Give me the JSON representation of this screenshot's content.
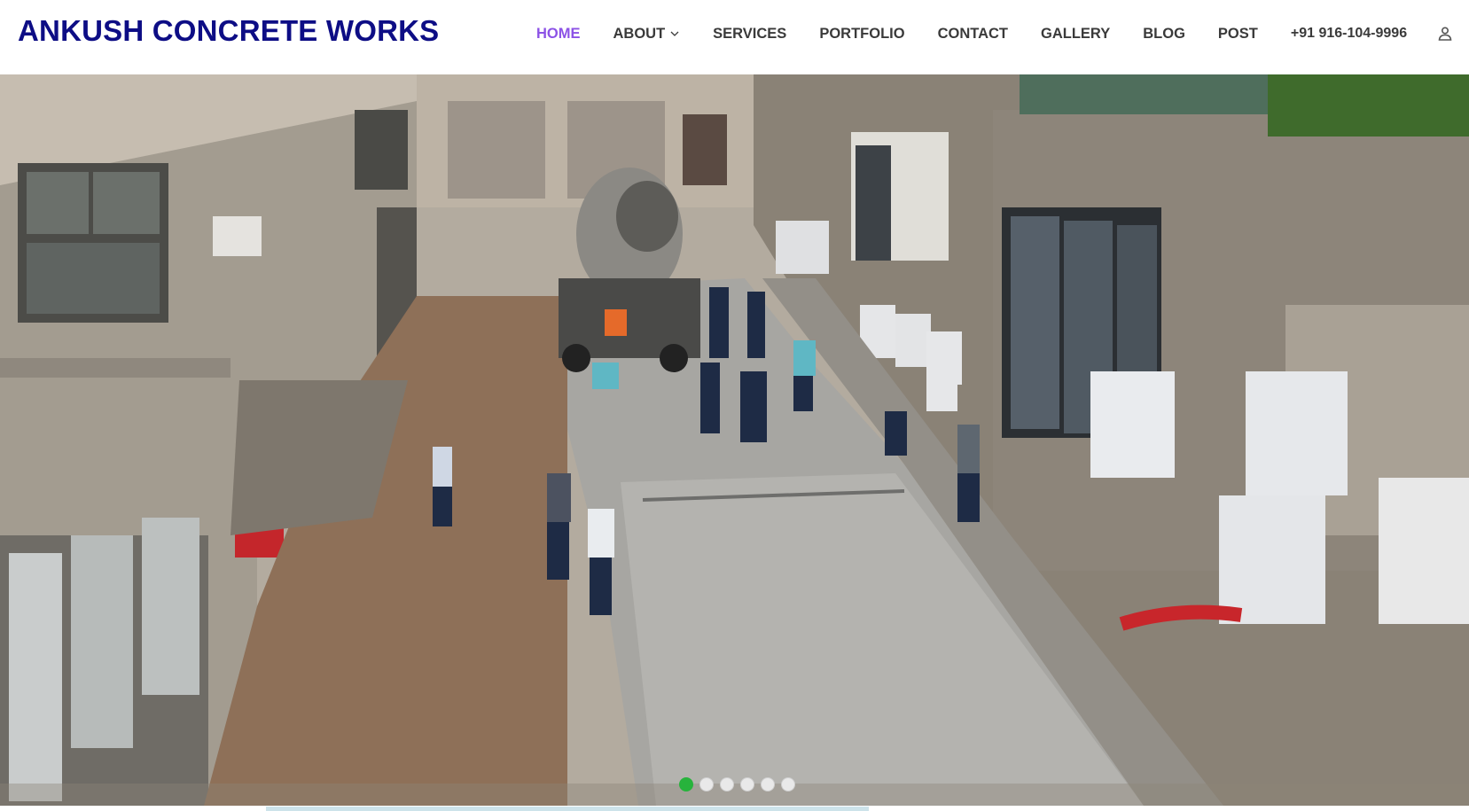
{
  "brand": {
    "name": "ANKUSH CONCRETE WORKS"
  },
  "nav": {
    "items": [
      {
        "label": "HOME"
      },
      {
        "label": "ABOUT"
      },
      {
        "label": "SERVICES"
      },
      {
        "label": "PORTFOLIO"
      },
      {
        "label": "CONTACT"
      },
      {
        "label": "GALLERY"
      },
      {
        "label": "BLOG"
      },
      {
        "label": "POST"
      }
    ],
    "active": "HOME",
    "phone": "+91 916-104-9996"
  },
  "icons": {
    "about_dropdown": "chevron-down-icon",
    "account": "user-icon"
  },
  "hero": {
    "image": "construction workers pouring and leveling concrete between buildings",
    "slides_total": 6,
    "current_slide": 1
  },
  "colors": {
    "brand": "#0d0d85",
    "nav_active": "#8c52e6",
    "dot_active": "#27b33c"
  }
}
